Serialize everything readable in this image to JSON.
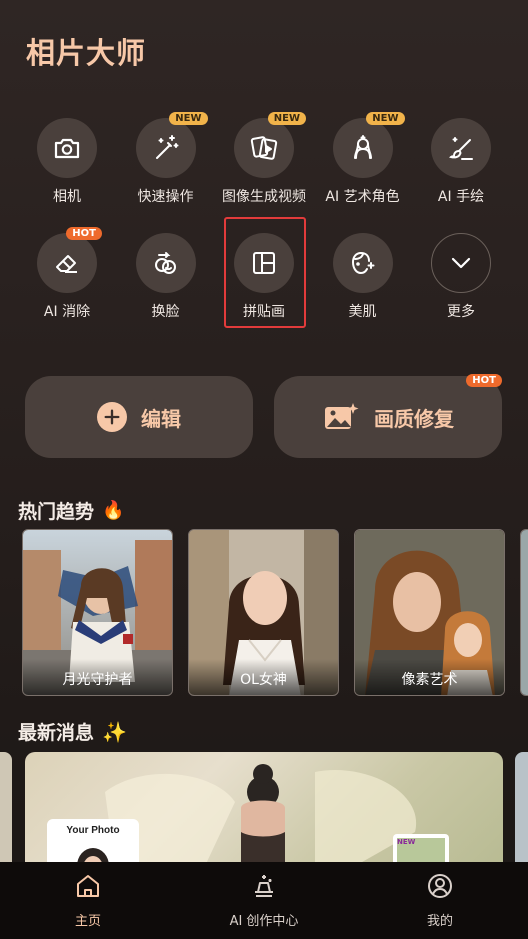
{
  "app": {
    "title": "相片大师"
  },
  "tools": [
    {
      "id": "camera",
      "label": "相机",
      "icon": "camera-icon",
      "badge": ""
    },
    {
      "id": "quick-action",
      "label": "快速操作",
      "icon": "magic-wand-icon",
      "badge": "NEW"
    },
    {
      "id": "image-to-video",
      "label": "图像生成视频",
      "icon": "cards-play-icon",
      "badge": "NEW"
    },
    {
      "id": "ai-art-role",
      "label": "AI 艺术角色",
      "icon": "portrait-sparkle-icon",
      "badge": "NEW"
    },
    {
      "id": "ai-draw",
      "label": "AI 手绘",
      "icon": "paint-brush-icon",
      "badge": ""
    },
    {
      "id": "ai-erase",
      "label": "AI 消除",
      "icon": "eraser-icon",
      "badge": "HOT"
    },
    {
      "id": "face-swap",
      "label": "换脸",
      "icon": "face-swap-icon",
      "badge": ""
    },
    {
      "id": "collage",
      "label": "拼贴画",
      "icon": "collage-layout-icon",
      "badge": ""
    },
    {
      "id": "beauty",
      "label": "美肌",
      "icon": "face-sparkle-icon",
      "badge": ""
    },
    {
      "id": "more",
      "label": "更多",
      "icon": "chevron-down-icon",
      "badge": ""
    }
  ],
  "actions": {
    "edit": {
      "label": "编辑",
      "icon": "plus-circle-icon"
    },
    "enhance": {
      "label": "画质修复",
      "icon": "image-sparkle-icon",
      "badge": "HOT"
    }
  },
  "trending": {
    "title": "热门趋势",
    "emoji": "🔥",
    "cards": [
      {
        "label": "月光守护者"
      },
      {
        "label": "OL女神"
      },
      {
        "label": "像素艺术"
      }
    ]
  },
  "news": {
    "title": "最新消息",
    "emoji": "✨",
    "card": {
      "photo_label": "Your Photo",
      "badge": "NEW"
    }
  },
  "nav": [
    {
      "id": "home",
      "label": "主页",
      "icon": "home-icon",
      "active": true
    },
    {
      "id": "ai-center",
      "label": "AI 创作中心",
      "icon": "magic-hat-icon",
      "active": false
    },
    {
      "id": "me",
      "label": "我的",
      "icon": "user-icon",
      "active": false
    }
  ],
  "colors": {
    "accent": "#f7c8a8",
    "badge_new": "#f1b34a",
    "badge_hot": "#ee6a2c",
    "highlight": "#e23b3b"
  }
}
